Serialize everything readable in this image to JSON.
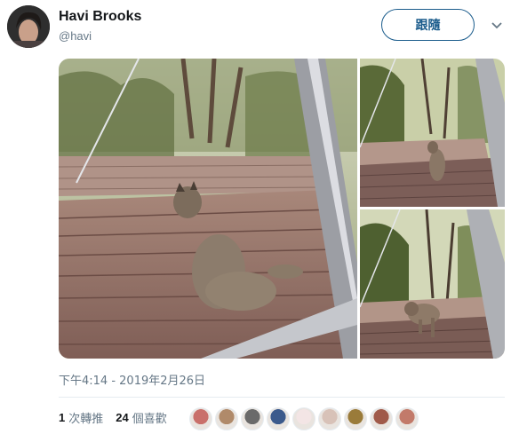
{
  "author": {
    "name": "Havi Brooks",
    "handle": "@havi"
  },
  "follow_button": {
    "label": "跟隨"
  },
  "menu": {
    "icon": "chevron-down-icon"
  },
  "media": {
    "photos": [
      {
        "subject": "bobcat-lying-on-deck"
      },
      {
        "subject": "bobcat-walking-away-on-deck"
      },
      {
        "subject": "bobcat-walking-on-deck"
      }
    ]
  },
  "timestamp": "下午4:14 - 2019年2月26日",
  "stats": {
    "retweets_count": "1",
    "retweets_label": "次轉推",
    "likes_count": "24",
    "likes_label": "個喜歡"
  },
  "likers": [
    {
      "color": "#c9706b"
    },
    {
      "color": "#b08a6a"
    },
    {
      "color": "#6a6a6a"
    },
    {
      "color": "#3b5a8c"
    },
    {
      "color": "#f3e5e5"
    },
    {
      "color": "#d8c2b8"
    },
    {
      "color": "#9a7b3a"
    },
    {
      "color": "#a05a4a"
    },
    {
      "color": "#c27a6a"
    }
  ],
  "colors": {
    "accent": "#1b5c8c",
    "secondary_text": "#657786",
    "primary_text": "#14171a"
  }
}
